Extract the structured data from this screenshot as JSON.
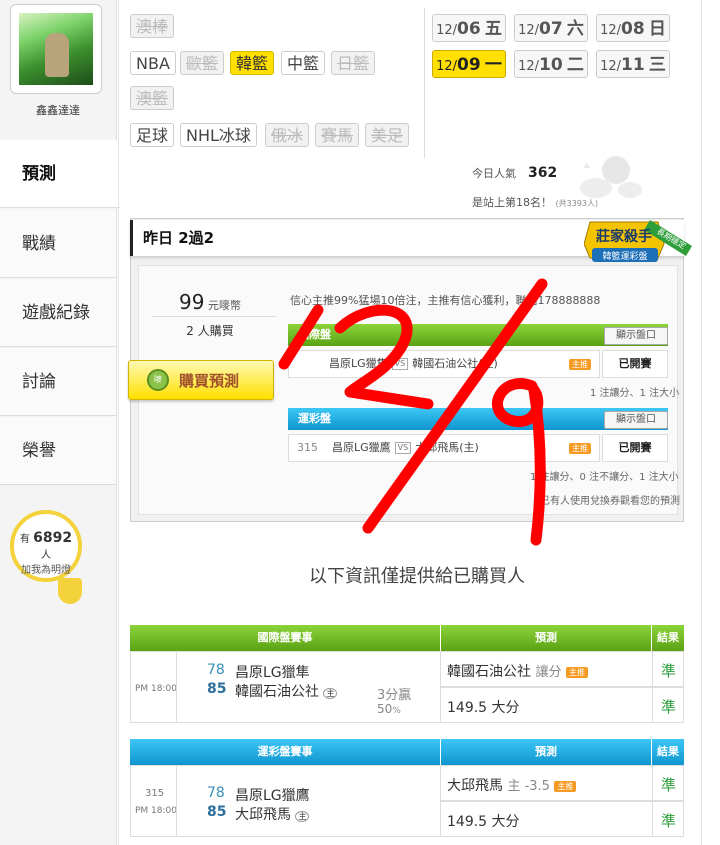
{
  "sidebar": {
    "username": "鑫鑫達達",
    "items": [
      "預測",
      "戰績",
      "遊戲紀錄",
      "討論",
      "榮譽"
    ],
    "active_item": "預測",
    "fans_prefix": "有",
    "fans_count": "6892",
    "fans_suffix": "人",
    "fans_text": "加我為明燈"
  },
  "leagues": {
    "row1": [
      {
        "label": "澳棒",
        "state": "disabled"
      }
    ],
    "row2": [
      {
        "label": "NBA",
        "state": "normal"
      },
      {
        "label": "歐籃",
        "state": "disabled"
      },
      {
        "label": "韓籃",
        "state": "active"
      },
      {
        "label": "中籃",
        "state": "normal"
      },
      {
        "label": "日籃",
        "state": "disabled"
      }
    ],
    "row3": [
      {
        "label": "澳籃",
        "state": "disabled"
      }
    ],
    "row4": [
      {
        "label": "足球",
        "state": "normal"
      },
      {
        "label": "NHL冰球",
        "state": "normal"
      },
      {
        "label": "俄冰",
        "state": "disabled"
      },
      {
        "label": "賽馬",
        "state": "disabled"
      },
      {
        "label": "美足",
        "state": "disabled"
      }
    ]
  },
  "dates": [
    {
      "month": "12/",
      "day": "06",
      "weekday": "五",
      "active": false
    },
    {
      "month": "12/",
      "day": "07",
      "weekday": "六",
      "active": false
    },
    {
      "month": "12/",
      "day": "08",
      "weekday": "日",
      "active": false
    },
    {
      "month": "12/",
      "day": "09",
      "weekday": "一",
      "active": true
    },
    {
      "month": "12/",
      "day": "10",
      "weekday": "二",
      "active": false
    },
    {
      "month": "12/",
      "day": "11",
      "weekday": "三",
      "active": false
    }
  ],
  "popularity": {
    "label": "今日人氣",
    "value": "362",
    "rank_text": "是站上第18名！",
    "rank_total": "(共3393人)"
  },
  "card": {
    "title": "昨日 2過2",
    "badge_line1": "莊家殺手",
    "badge_line2": "韓籃運彩盤",
    "badge_ribbon": "長期穩定",
    "price_value": "99",
    "price_unit": "元嘜幣",
    "buyers": "2 人購買",
    "buy_button": "購買預測",
    "coin_label": "嘜",
    "description": "信心主推99%猛場10倍注，主推有信心獲利，聯絡178888888",
    "intl": {
      "header": "國際盤",
      "show_button": "顯示盤口",
      "match_home": "昌原LG獵隼",
      "match_vs": "VS",
      "match_away": "韓國石油公社(主)",
      "tag": "主推",
      "status": "已開賽",
      "summary": "1 注讓分、1 注大小"
    },
    "sports": {
      "header": "運彩盤",
      "show_button": "顯示盤口",
      "code": "315",
      "match_home": "昌原LG獵鷹",
      "match_vs": "VS",
      "match_away": "大邱飛馬(主)",
      "tag": "主推",
      "status": "已開賽",
      "summary": "1 注讓分、0 注不讓分、1 注大小",
      "note": "已有人使用兌換券觀看您的預測"
    }
  },
  "handwriting": "12/9",
  "info_text": "以下資訊僅提供給已購買人",
  "intl_table": {
    "headers": [
      "國際盤賽事",
      "預測",
      "結果"
    ],
    "time": "PM 18:00",
    "team1_score": "78",
    "team1_name": "昌原LG獵隼",
    "team2_score": "85",
    "team2_name": "韓國石油公社",
    "home_mark": "主",
    "margin": "3分贏",
    "pct": "50",
    "pct_unit": "%",
    "pick1_team": "韓國石油公社",
    "pick1_type": "讓分",
    "pick_tag": "主推",
    "result1": "準",
    "pick2": "149.5 大分",
    "result2": "準"
  },
  "sports_table": {
    "headers": [
      "運彩盤賽事",
      "預測",
      "結果"
    ],
    "code": "315",
    "time": "PM 18:00",
    "team1_score": "78",
    "team1_name": "昌原LG獵鷹",
    "team2_score": "85",
    "team2_name": "大邱飛馬",
    "home_mark": "主",
    "pick1_team": "大邱飛馬",
    "pick1_type": "主 -3.5",
    "pick_tag": "主推",
    "result1": "準",
    "pick2": "149.5 大分",
    "result2": "準"
  },
  "colors": {
    "yellow": "#ffe000",
    "green": "#5aa214",
    "blue": "#0f95cf",
    "red_pen": "#ff0000",
    "result_green": "#2a9d3a"
  }
}
